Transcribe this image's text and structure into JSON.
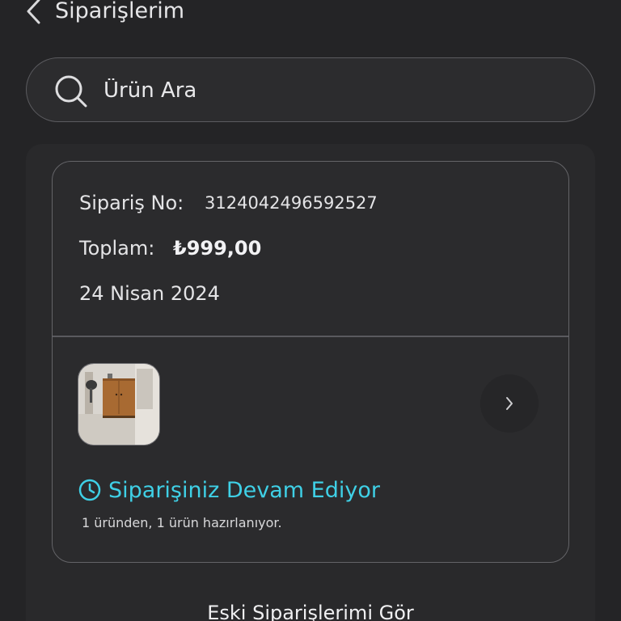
{
  "header": {
    "back_icon": "chevron-left-icon",
    "title": "Siparişlerim"
  },
  "search": {
    "icon": "search-icon",
    "placeholder": "Ürün Ara",
    "value": ""
  },
  "order": {
    "order_no_label": "Sipariş No:",
    "order_no_value": "3124042496592527",
    "total_label": "Toplam:",
    "total_value": "₺999,00",
    "date": "24 Nisan 2024",
    "product_image": "wooden-shoe-cabinet-image",
    "detail_icon": "chevron-right-icon",
    "status_icon": "clock-icon",
    "status_text": "Siparişiniz Devam Ediyor",
    "status_color": "#3fd0e6",
    "status_detail": "1 üründen, 1 ürün hazırlanıyor."
  },
  "footer": {
    "old_orders_label": "Eski Siparişlerimi Gör"
  }
}
